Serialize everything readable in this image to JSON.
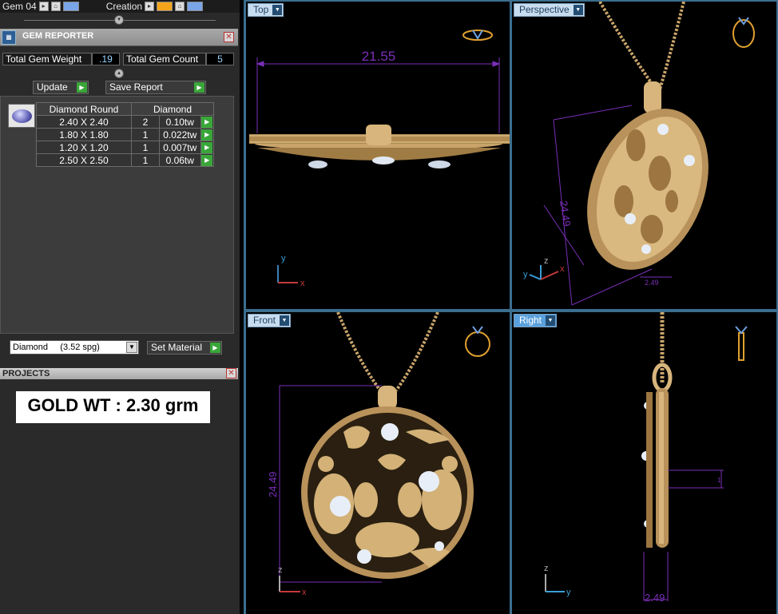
{
  "layer_bar": {
    "layer1": "Gem 04",
    "layer2": "Creation"
  },
  "gem_reporter": {
    "title": "GEM REPORTER",
    "total_weight_label": "Total Gem Weight",
    "total_weight_value": ".19",
    "total_count_label": "Total Gem Count",
    "total_count_value": "5",
    "update_label": "Update",
    "save_report_label": "Save Report",
    "table": {
      "headers": [
        "Diamond Round",
        "Diamond"
      ],
      "rows": [
        {
          "size": "2.40 X 2.40",
          "count": "2",
          "weight": "0.10tw"
        },
        {
          "size": "1.80 X 1.80",
          "count": "1",
          "weight": "0.022tw"
        },
        {
          "size": "1.20 X 1.20",
          "count": "1",
          "weight": "0.007tw"
        },
        {
          "size": "2.50 X 2.50",
          "count": "1",
          "weight": "0.06tw"
        }
      ]
    },
    "material_value": "Diamond     (3.52 spg)",
    "set_material_label": "Set Material"
  },
  "projects": {
    "title": "PROJECTS",
    "note": "GOLD WT : 2.30 grm"
  },
  "viewports": {
    "top": {
      "label": "Top",
      "dimension": "21.55"
    },
    "perspective": {
      "label": "Perspective",
      "dimension": "24.49",
      "dimension_small": "2.49"
    },
    "front": {
      "label": "Front",
      "dimension": "24.49"
    },
    "right": {
      "label": "Right",
      "dimension": "2.49",
      "dimension_small": "1"
    }
  },
  "axes": {
    "x": "x",
    "y": "y",
    "z": "z"
  },
  "colors": {
    "gold": "#c9a46a",
    "dimension": "#7a2fb8",
    "viewport_border": "#3b6e8f",
    "active_label": "#5aa0dc"
  }
}
